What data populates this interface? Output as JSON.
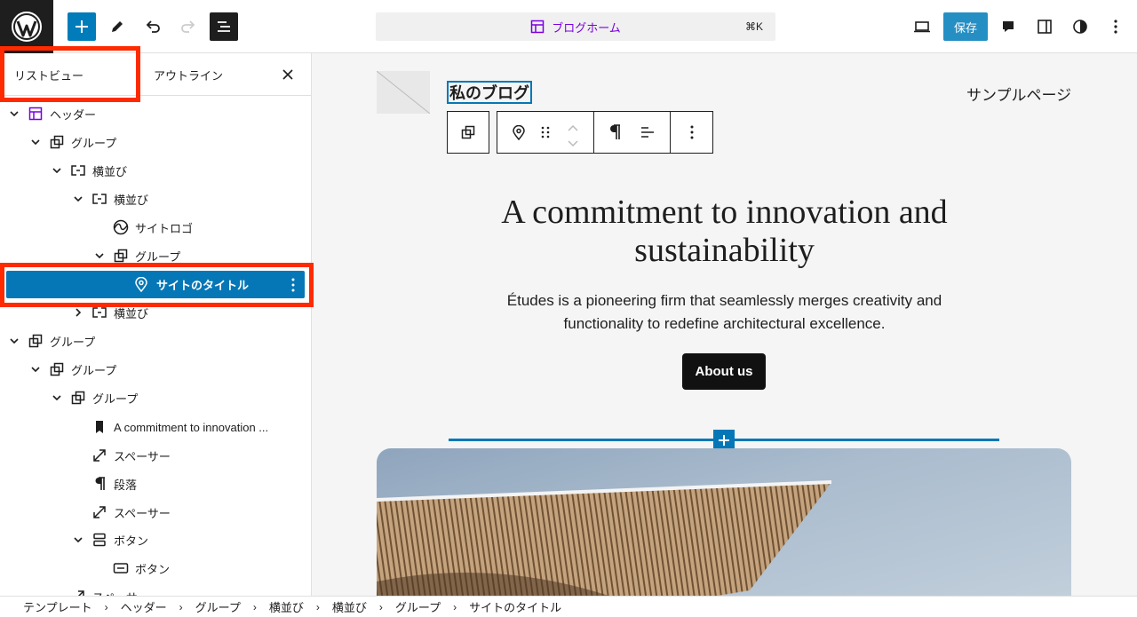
{
  "topbar": {
    "command_label": "ブログホーム",
    "command_shortcut": "⌘K",
    "save_label": "保存"
  },
  "sidebar": {
    "tab_list": "リストビュー",
    "tab_outline": "アウトライン",
    "items": [
      {
        "label": "ヘッダー"
      },
      {
        "label": "グループ"
      },
      {
        "label": "横並び"
      },
      {
        "label": "横並び"
      },
      {
        "label": "サイトロゴ"
      },
      {
        "label": "グループ"
      },
      {
        "label": "サイトのタイトル"
      },
      {
        "label": "横並び"
      },
      {
        "label": "グループ"
      },
      {
        "label": "グループ"
      },
      {
        "label": "グループ"
      },
      {
        "label": "A commitment to innovation ..."
      },
      {
        "label": "スペーサー"
      },
      {
        "label": "段落"
      },
      {
        "label": "スペーサー"
      },
      {
        "label": "ボタン"
      },
      {
        "label": "ボタン"
      },
      {
        "label": "スペーサー"
      }
    ]
  },
  "canvas": {
    "site_title": "私のブログ",
    "nav_link": "サンプルページ",
    "heading_line1": "A commitment to innovation and",
    "heading_line2": "sustainability",
    "paragraph_line1": "Études is a pioneering firm that seamlessly merges creativity and",
    "paragraph_line2": "functionality to redefine architectural excellence.",
    "button_label": "About us"
  },
  "breadcrumb": [
    "テンプレート",
    "ヘッダー",
    "グループ",
    "横並び",
    "横並び",
    "グループ",
    "サイトのタイトル"
  ],
  "colors": {
    "accent": "#007cba",
    "highlight": "#ff2a00",
    "template_purple": "#7a00df"
  }
}
